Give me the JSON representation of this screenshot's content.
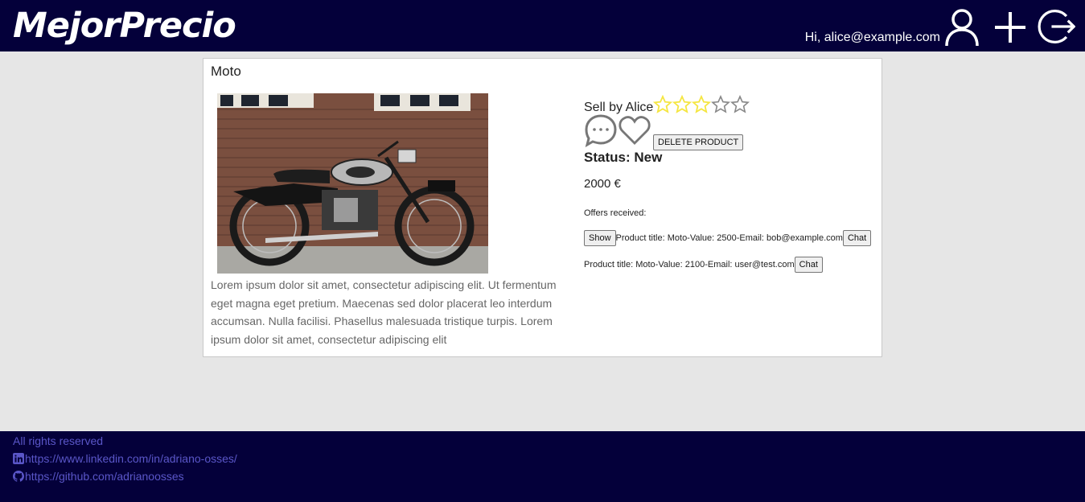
{
  "header": {
    "logo": "MejorPrecio",
    "greeting": "Hi, alice@example.com",
    "icons": [
      "user-icon",
      "plus-icon",
      "logout-icon"
    ]
  },
  "product": {
    "title": "Moto",
    "description": "Lorem ipsum dolor sit amet, consectetur adipiscing elit. Ut fermentum eget magna eget pretium. Maecenas sed dolor placerat leo interdum accumsan. Nulla facilisi. Phasellus malesuada tristique turpis. Lorem ipsum dolor sit amet, consectetur adipiscing elit",
    "seller": "Sell by Alice",
    "rating": 3,
    "rating_max": 5,
    "delete_label": "DELETE PRODUCT",
    "status": "Status: New",
    "price": "2000 €",
    "offers_label": "Offers received:",
    "show_label": "Show",
    "offers": [
      {
        "text": "Product title: Moto-Value: 2500-Email: bob@example.com",
        "chat_label": "Chat"
      },
      {
        "text": "Product title: Moto-Value: 2100-Email: user@test.com",
        "chat_label": "Chat"
      }
    ]
  },
  "footer": {
    "rights": "All rights reserved",
    "linkedin": "https://www.linkedin.com/in/adriano-osses/",
    "github": "https://github.com/adrianoosses"
  },
  "colors": {
    "header_bg": "#04003a",
    "page_bg": "#e6e6e6",
    "star_filled": "#f5e642",
    "footer_text": "#5a56c8"
  }
}
